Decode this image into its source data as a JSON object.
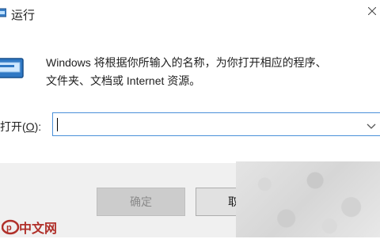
{
  "window": {
    "title": "运行"
  },
  "description": {
    "line1": "Windows 将根据你所输入的名称，为你打开相应的程序、",
    "line2": "文件夹、文档或 Internet 资源。"
  },
  "open_field": {
    "label_prefix": "打开(",
    "label_hotkey": "O",
    "label_suffix": "):",
    "value": "",
    "dropdown_icon": "chevron-down-icon"
  },
  "buttons": {
    "ok_label": "确定",
    "cancel_label": "取"
  },
  "watermark": {
    "text": "中文网"
  },
  "colors": {
    "focus_border": "#4a90d9",
    "footer_bg": "#f0f0f0",
    "disabled_button_bg": "#cccccc",
    "watermark_red": "#b0302a"
  },
  "icons": {
    "title": "run-icon",
    "dialog": "run-program-icon",
    "close": "close-icon"
  }
}
